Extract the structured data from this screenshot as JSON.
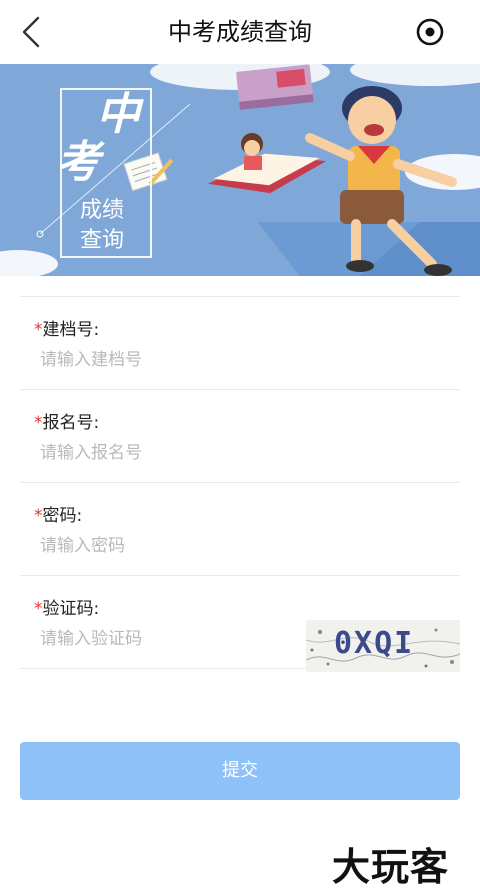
{
  "header": {
    "title": "中考成绩查询",
    "back_icon": "chevron-left-icon",
    "target_icon": "target-icon"
  },
  "banner": {
    "title_big_1": "中",
    "title_big_2": "考",
    "title_small_1": "成绩",
    "title_small_2": "查询"
  },
  "form": {
    "fields": [
      {
        "required": "*",
        "label": "建档号:",
        "placeholder": "请输入建档号"
      },
      {
        "required": "*",
        "label": "报名号:",
        "placeholder": "请输入报名号"
      },
      {
        "required": "*",
        "label": "密码:",
        "placeholder": "请输入密码"
      },
      {
        "required": "*",
        "label": "验证码:",
        "placeholder": "请输入验证码"
      }
    ],
    "captcha_text": "0XQI"
  },
  "submit_label": "提交",
  "watermark": "大玩客",
  "colors": {
    "banner_bg": "#7fa7d8",
    "submit_bg": "#8ec1f8",
    "required": "#e0362e"
  }
}
